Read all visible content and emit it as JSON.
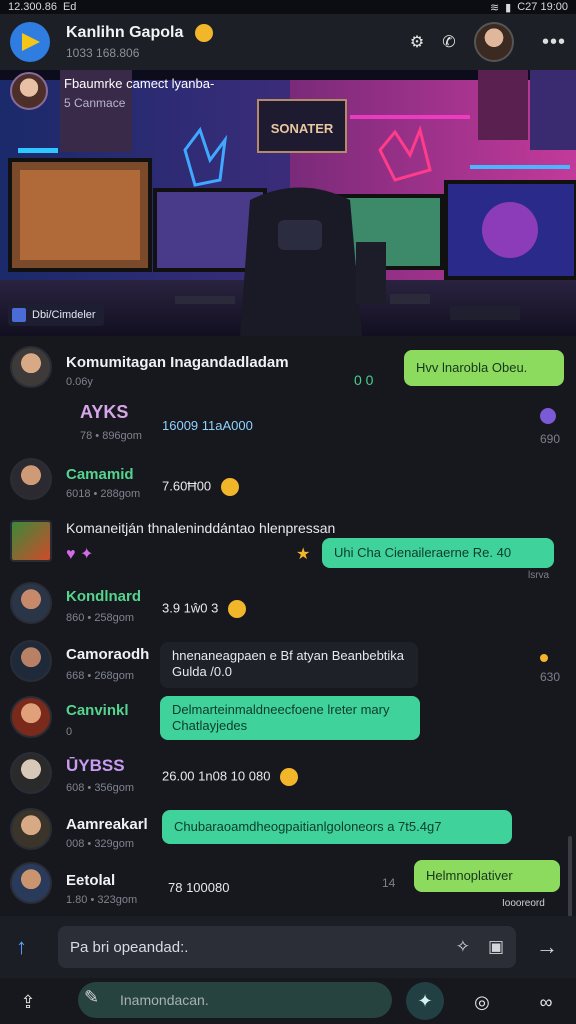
{
  "status": {
    "time_left": "12.300.86",
    "signal_left": "Ed",
    "time_right": "C27 19:00"
  },
  "header": {
    "title": "Kanlihn Gapola",
    "subtitle": "1033 168.806"
  },
  "banner": {
    "title": "Fbaumrke camect lyanba-",
    "subtitle": "5 Canmace",
    "tag": "Dbi/Cimdeler",
    "sign": "SONATER"
  },
  "messages": [
    {
      "name": "Komumitagan Inagandadladam",
      "sub": "0.06y",
      "name_color": "white"
    },
    {
      "title": "AYKS",
      "time": "78 • 896gom",
      "text": "16009 11aA000"
    },
    {
      "name": "Camamid",
      "sub": "6018 • 288gom",
      "text": "7.60Ħ00",
      "name_color": "green"
    },
    {
      "text": "Komaneitján thnaleninddántao hlenpressan"
    },
    {
      "name": "Kondlnard",
      "sub": "860 • 258gom",
      "text": "3.9 1ŵ0 3",
      "name_color": "green"
    },
    {
      "name": "Camoraodh",
      "sub": "668 • 268gom",
      "text": "hnenaneagpaen e Bf atyan Beanbebtika",
      "text2": "Gulda /0.0"
    },
    {
      "name": "Canvinkl",
      "sub": "0",
      "name_color": "green"
    },
    {
      "title": "ŪYBSS",
      "sub": "608 • 356gom",
      "text": "26.00 1n08 10 080"
    },
    {
      "name": "Aamreakarl",
      "sub": "008 • 329gom"
    },
    {
      "name": "Eetolal",
      "sub": "1.80 • 323gom",
      "text": "78 100080"
    }
  ],
  "bubbles": {
    "b1": "Hvv lnarobla Obeu.",
    "b2": "Uhi Cha Cienaileraerne Re. 40",
    "b3": "Delmarteinmaldneecfoene lreter mary",
    "b3b": "Chatlayjedes",
    "b4": "Chubaraoamdheogpaitianlgoloneors a 7t5.4g7",
    "b5": "Helmnoplativer"
  },
  "ticks": {
    "t1": "0 0",
    "t2": "690",
    "t3": "lsrva",
    "t4": "630",
    "t5": "14",
    "t6": "Ioooreord"
  },
  "input": {
    "placeholder": "Pa bri opeandad:."
  },
  "nav": {
    "field": "Inamondacan."
  }
}
